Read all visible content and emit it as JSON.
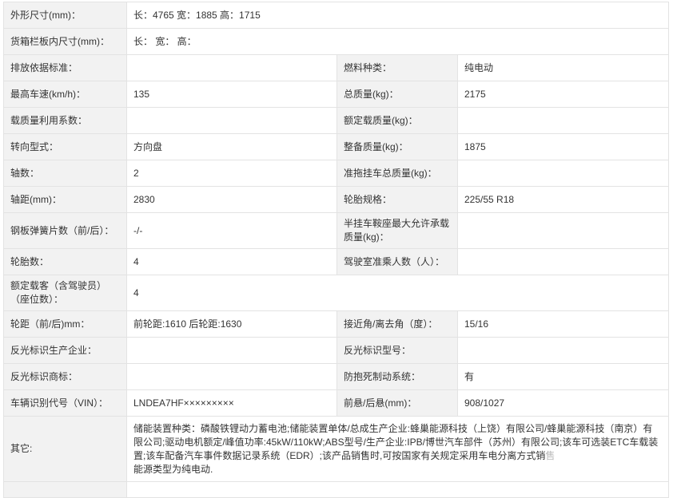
{
  "rows": [
    {
      "label": "外形尺寸(mm)：",
      "value": "长：4765 宽：1885 高：1715"
    },
    {
      "label": "货箱栏板内尺寸(mm)：",
      "value": "长：  宽：  高："
    },
    {
      "label": "排放依据标准：",
      "value": "",
      "label2": "燃料种类：",
      "value2": "纯电动"
    },
    {
      "label": "最高车速(km/h)：",
      "value": "135",
      "label2": "总质量(kg)：",
      "value2": "2175"
    },
    {
      "label": "载质量利用系数：",
      "value": "",
      "label2": "额定载质量(kg)：",
      "value2": ""
    },
    {
      "label": "转向型式：",
      "value": "方向盘",
      "label2": "整备质量(kg)：",
      "value2": "1875"
    },
    {
      "label": "轴数：",
      "value": "2",
      "label2": "准拖挂车总质量(kg)：",
      "value2": ""
    },
    {
      "label": "轴距(mm)：",
      "value": "2830",
      "label2": "轮胎规格：",
      "value2": "225/55 R18"
    },
    {
      "label": "钢板弹簧片数（前/后）：",
      "value": "-/-",
      "label2": "半挂车鞍座最大允许承载质量(kg)：",
      "value2": ""
    },
    {
      "label": "轮胎数：",
      "value": "4",
      "label2": "驾驶室准乘人数（人）：",
      "value2": ""
    },
    {
      "label": "额定载客（含驾驶员）（座位数）：",
      "value": "4"
    },
    {
      "label": "轮距（前/后)mm：",
      "value": "前轮距:1610 后轮距:1630",
      "label2": "接近角/离去角（度）：",
      "value2": "15/16"
    },
    {
      "label": "反光标识生产企业：",
      "value": "",
      "label2": "反光标识型号：",
      "value2": ""
    },
    {
      "label": "反光标识商标：",
      "value": "",
      "label2": "防抱死制动系统：",
      "value2": "有"
    },
    {
      "label": "车辆识别代号（VIN）：",
      "value": "LNDEA7HF×××××××××",
      "label2": "前悬/后悬(mm)：",
      "value2": "908/1027"
    }
  ],
  "other": {
    "label": "其它:",
    "text": "储能装置种类：磷酸铁锂动力蓄电池;储能装置单体/总成生产企业:蜂巢能源科技（上饶）有限公司/蜂巢能源科技（南京）有限公司;驱动电机额定/峰值功率:45kW/110kW;ABS型号/生产企业:IPB/博世汽车部件（苏州）有限公司;该车可选装ETC车载装置;该车配备汽车事件数据记录系统（EDR）;该产品销售时,可按国家有关规定采用车电分离方式销",
    "tail": "售",
    "line2": "能源类型为纯电动."
  }
}
